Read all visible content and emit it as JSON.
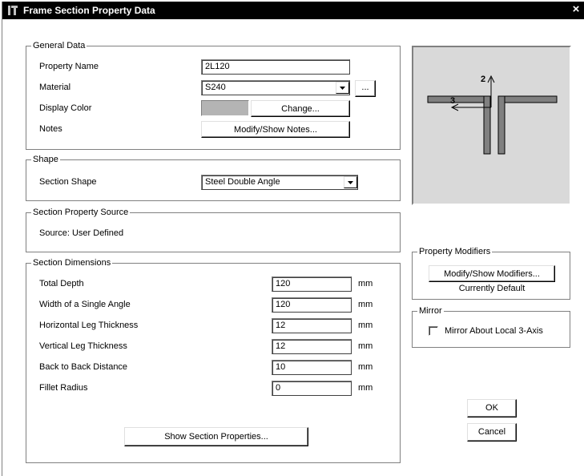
{
  "window": {
    "title": "Frame Section Property Data",
    "close_glyph": "×"
  },
  "general": {
    "legend": "General Data",
    "property_name_label": "Property Name",
    "property_name_value": "2L120",
    "material_label": "Material",
    "material_value": "S240",
    "material_more_label": "...",
    "display_color_label": "Display Color",
    "display_color_swatch": "#b4b4b4",
    "change_button": "Change...",
    "notes_label": "Notes",
    "notes_button": "Modify/Show Notes..."
  },
  "shape": {
    "legend": "Shape",
    "section_shape_label": "Section Shape",
    "section_shape_value": "Steel Double Angle"
  },
  "source": {
    "legend": "Section Property Source",
    "text": "Source:  User Defined"
  },
  "dimensions": {
    "legend": "Section Dimensions",
    "rows": [
      {
        "label": "Total Depth",
        "value": "120",
        "unit": "mm"
      },
      {
        "label": "Width of a Single Angle",
        "value": "120",
        "unit": "mm"
      },
      {
        "label": "Horizontal Leg Thickness",
        "value": "12",
        "unit": "mm"
      },
      {
        "label": "Vertical Leg Thickness",
        "value": "12",
        "unit": "mm"
      },
      {
        "label": "Back to Back Distance",
        "value": "10",
        "unit": "mm"
      },
      {
        "label": "Fillet Radius",
        "value": "0",
        "unit": "mm"
      }
    ],
    "show_properties_button": "Show Section Properties..."
  },
  "preview": {
    "axis_2_label": "2",
    "axis_3_label": "3",
    "background": "#d9d9d9",
    "section_fill": "#808080"
  },
  "modifiers": {
    "legend": "Property Modifiers",
    "button": "Modify/Show Modifiers...",
    "status": "Currently Default"
  },
  "mirror": {
    "legend": "Mirror",
    "checkbox_label": "Mirror About Local 3-Axis",
    "checked": false
  },
  "actions": {
    "ok": "OK",
    "cancel": "Cancel"
  }
}
